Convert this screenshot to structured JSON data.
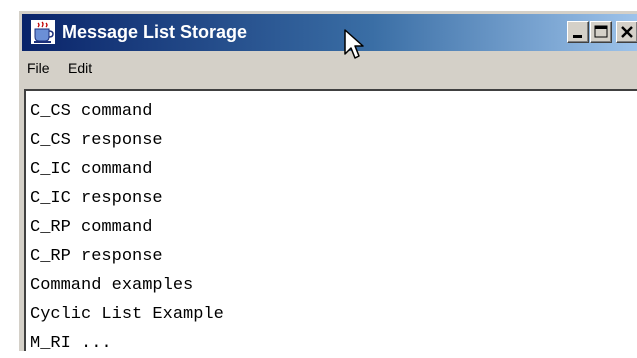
{
  "window": {
    "title": "Message List Storage",
    "controls": [
      "minimize",
      "maximize",
      "close"
    ]
  },
  "menubar": {
    "items": [
      "File",
      "Edit"
    ]
  },
  "message_list": {
    "items": [
      "C_CS command",
      "C_CS response",
      "C_IC command",
      "C_IC response",
      "C_RP command",
      "C_RP response",
      "Command examples",
      "Cyclic List Example",
      "M_RI ..."
    ]
  },
  "icons": {
    "app": "java-cup-icon",
    "cursor": "mouse-pointer-icon"
  },
  "colors": {
    "titlebar_start": "#0a246a",
    "titlebar_end": "#a6caf0",
    "chrome": "#d4d0c8"
  }
}
